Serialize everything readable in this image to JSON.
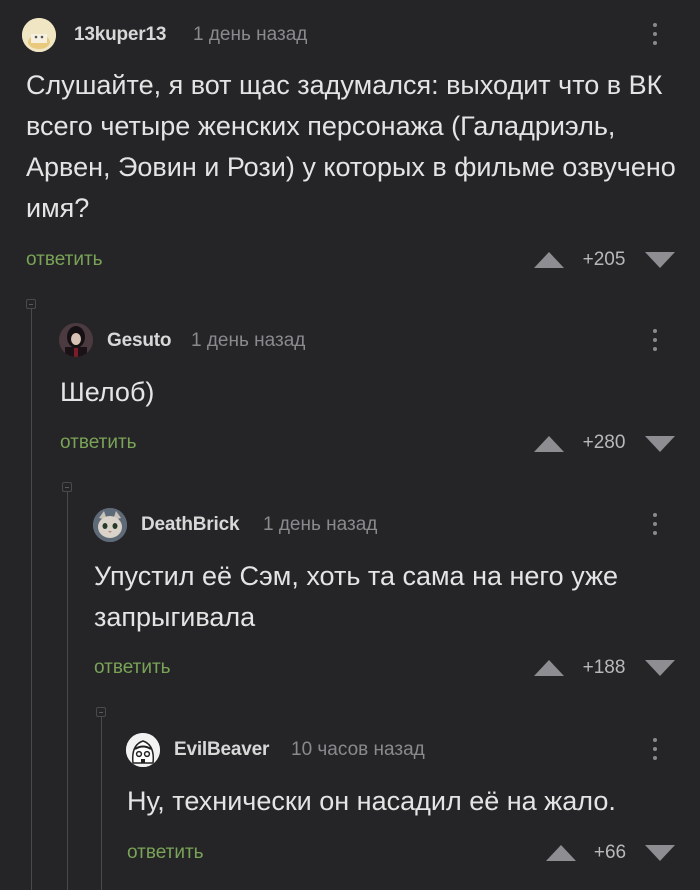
{
  "comments": [
    {
      "username": "13kuper13",
      "timestamp": "1 день назад",
      "text": "Слушайте, я вот щас задумался: выходит что в ВК всего четыре женских персонажа (Галадриэль, Арвен, Эовин и Рози) у которых в фильме озвучено имя?",
      "reply_label": "ответить",
      "rating": "+205"
    },
    {
      "username": "Gesuto",
      "timestamp": "1 день назад",
      "text": "Шелоб)",
      "reply_label": "ответить",
      "rating": "+280"
    },
    {
      "username": "DeathBrick",
      "timestamp": "1 день назад",
      "text": "Упустил её Сэм, хоть та сама на него уже запрыгивала",
      "reply_label": "ответить",
      "rating": "+188"
    },
    {
      "username": "EvilBeaver",
      "timestamp": "10 часов назад",
      "text": "Ну, технически он насадил её на жало.",
      "reply_label": "ответить",
      "rating": "+66"
    }
  ],
  "colors": {
    "background": "#252527",
    "reply_link": "#79a357",
    "thread_line": "#4a4a4e"
  }
}
